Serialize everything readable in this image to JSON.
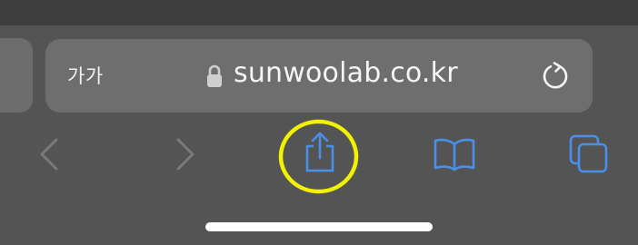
{
  "address_bar": {
    "text_size_label": "가가",
    "url": "sunwoolab.co.kr",
    "lock_icon": "lock-icon",
    "reload_icon": "reload-icon"
  },
  "toolbar": {
    "back_icon": "chevron-left-icon",
    "forward_icon": "chevron-right-icon",
    "share_icon": "share-icon",
    "bookmarks_icon": "book-icon",
    "tabs_icon": "tabs-icon"
  },
  "colors": {
    "background": "#545454",
    "address_bar": "#6e6e6e",
    "accent": "#4a8fe8",
    "disabled": "#7a7a7a",
    "highlight_ring": "#f2f200"
  }
}
